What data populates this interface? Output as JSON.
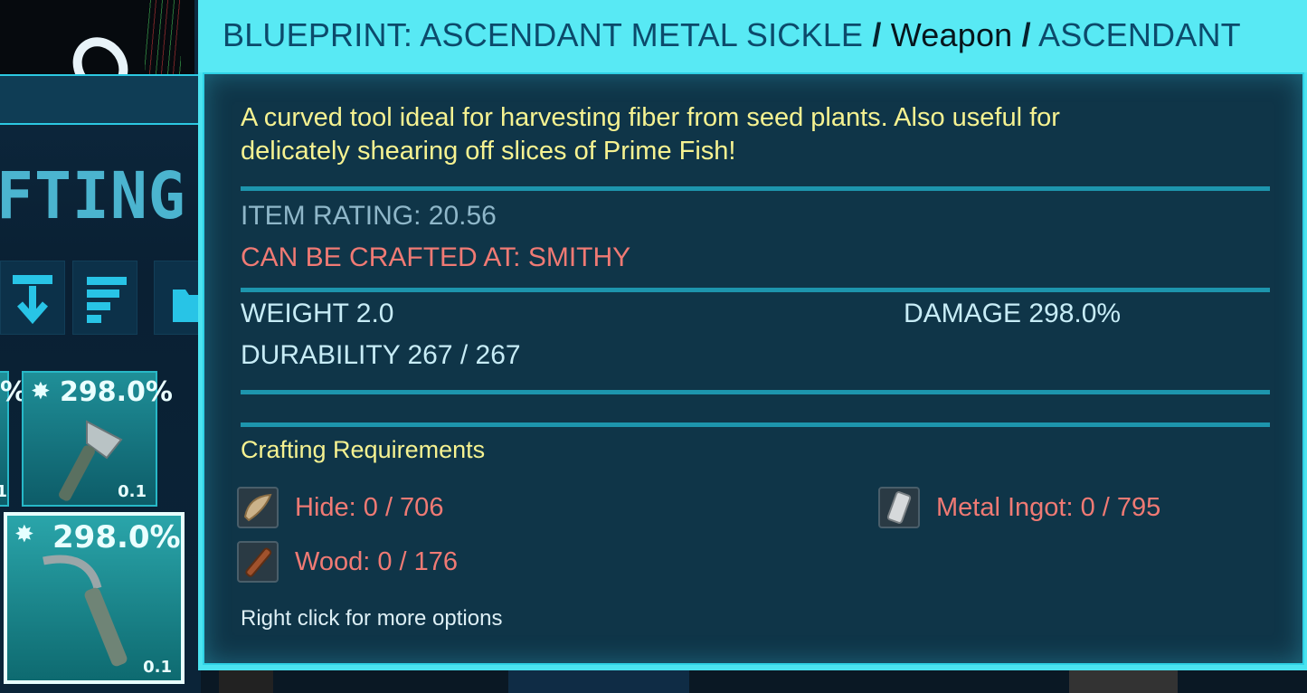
{
  "background": {
    "section_title": "FTING",
    "slots": [
      {
        "percent": "298.0%",
        "weight": "0.1",
        "item_icon": "hatchet-icon"
      },
      {
        "percent": "298.0%",
        "weight": "0.1",
        "item_icon": "sickle-icon",
        "selected": true
      }
    ],
    "partial_left": {
      "percent_fragment": "%",
      "weight_fragment": "1"
    }
  },
  "tooltip": {
    "title": {
      "name": "BLUEPRINT: ASCENDANT METAL SICKLE",
      "separator": "/",
      "category": "Weapon",
      "quality": "ASCENDANT"
    },
    "description": "A curved tool ideal for harvesting fiber from seed plants. Also useful for delicately shearing off slices of Prime Fish!",
    "item_rating": "ITEM RATING: 20.56",
    "crafted_at": "CAN BE CRAFTED AT: SMITHY",
    "weight": "WEIGHT 2.0",
    "damage": "DAMAGE 298.0%",
    "durability": "DURABILITY 267 / 267",
    "requirements_title": "Crafting Requirements",
    "requirements": [
      {
        "label": "Hide: 0 / 706",
        "icon": "hide-icon"
      },
      {
        "label": "Metal Ingot: 0 / 795",
        "icon": "metal-ingot-icon"
      },
      {
        "label": "Wood: 0 / 176",
        "icon": "wood-icon"
      }
    ],
    "hint": "Right click for more options"
  },
  "colors": {
    "header": "#58e9f4",
    "title_text": "#0c4a6b",
    "description": "#f6f291",
    "requirement_missing": "#f07a74",
    "divider": "#1d95ad"
  }
}
